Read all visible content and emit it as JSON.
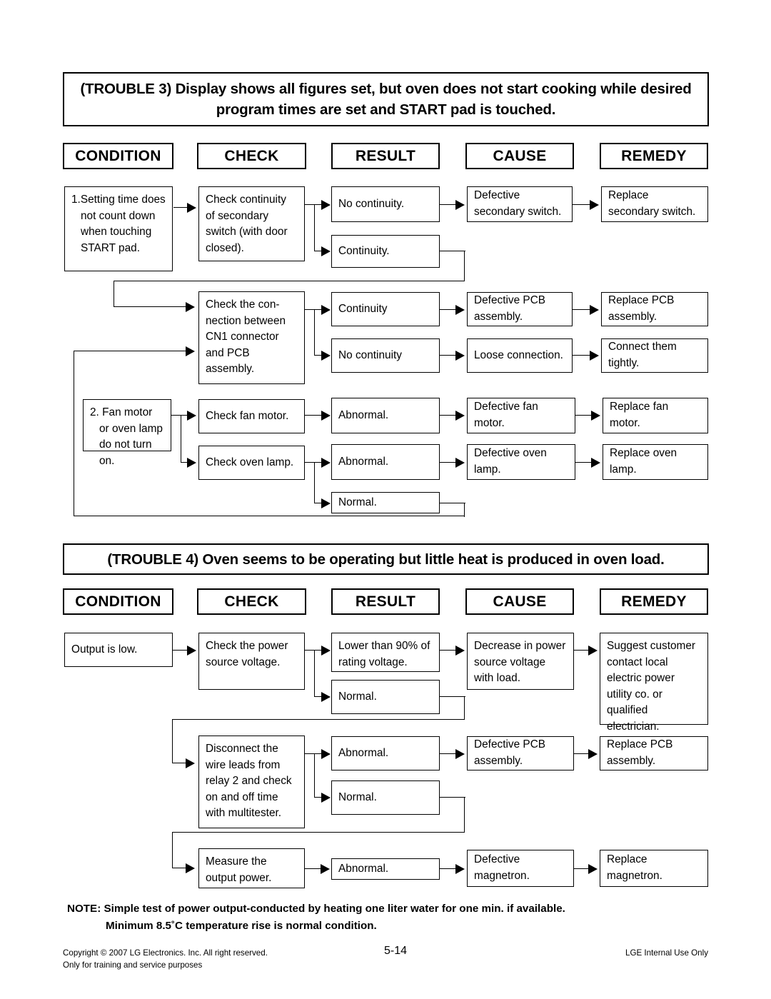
{
  "trouble3": {
    "banner": "(TROUBLE 3) Display shows all figures set, but oven does not start cooking while desired program times are set and START pad is touched.",
    "columns": [
      "CONDITION",
      "CHECK",
      "RESULT",
      "CAUSE",
      "REMEDY"
    ],
    "boxes": {
      "cond1": "1.Setting time does not count down when touching START pad.",
      "check1": "Check continuity of secondary switch (with door closed).",
      "result1a": "No continuity.",
      "result1b": "Continuity.",
      "cause1a": "Defective secondary switch.",
      "remedy1a": "Replace secondary switch.",
      "check2": "Check the con-nection between CN1 connector and PCB assembly.",
      "result2a": "Continuity",
      "result2b": "No continuity",
      "cause2a": "Defective PCB assembly.",
      "remedy2a": "Replace PCB assembly.",
      "cause2b": "Loose connection.",
      "remedy2b": "Connect them tightly.",
      "cond2": "2. Fan motor or oven lamp do not turn on.",
      "check3": "Check fan motor.",
      "result3a": "Abnormal.",
      "cause3a": "Defective fan motor.",
      "remedy3a": "Replace fan motor.",
      "check4": "Check oven lamp.",
      "result4a": "Abnormal.",
      "cause4a": "Defective oven lamp.",
      "remedy4a": "Replace oven lamp.",
      "result4b": "Normal."
    }
  },
  "trouble4": {
    "banner": "(TROUBLE 4) Oven seems to be operating but little heat is produced in oven load.",
    "columns": [
      "CONDITION",
      "CHECK",
      "RESULT",
      "CAUSE",
      "REMEDY"
    ],
    "boxes": {
      "cond1": "Output is low.",
      "check1": "Check the power source voltage.",
      "result1a": "Lower than 90% of rating voltage.",
      "result1b": "Normal.",
      "cause1a": "Decrease in power source voltage with load.",
      "remedy1a": "Suggest customer contact local electric power utility co. or qualified electrician.",
      "check2": "Disconnect the wire leads from relay 2 and check on and off time with multitester.",
      "result2a": "Abnormal.",
      "result2b": "Normal.",
      "cause2a": "Defective PCB assembly.",
      "remedy2a": "Replace  PCB assembly.",
      "check3": "Measure the output power.",
      "result3a": "Abnormal.",
      "cause3a": "Defective magnetron.",
      "remedy3a": "Replace magnetron."
    }
  },
  "note": {
    "line1": "NOTE: Simple test of power output-conducted by heating one liter water for one min. if available.",
    "line2": "Minimum 8.5˚C temperature rise is normal condition."
  },
  "footer": {
    "copyright_line1": "Copyright © 2007 LG Electronics. Inc. All right reserved.",
    "copyright_line2": "Only for training and service purposes",
    "page_number": "5-14",
    "internal": "LGE Internal Use Only"
  }
}
